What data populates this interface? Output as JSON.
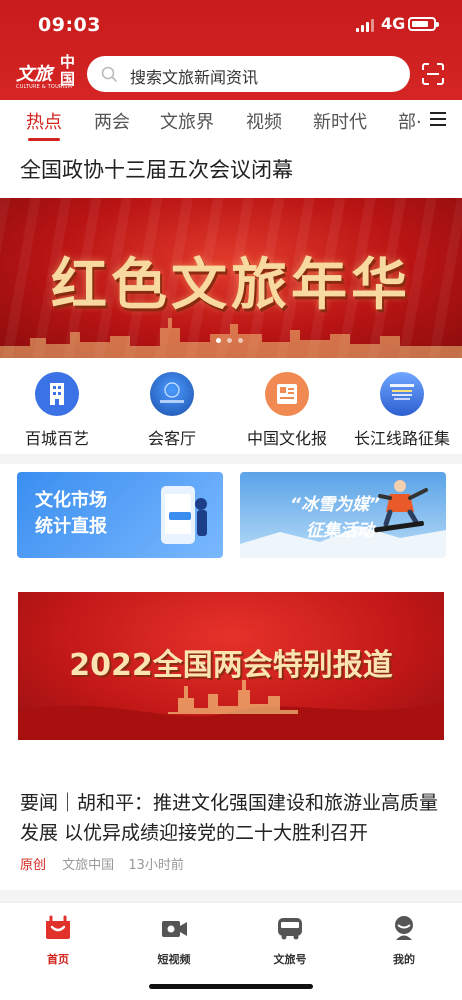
{
  "status_bar": {
    "time": "09:03",
    "network": "4G",
    "battery_level": 0.8
  },
  "header": {
    "logo_main": "文旅",
    "logo_side": "中国",
    "logo_sub": "CULTURE & TOURISM",
    "search_placeholder": "搜索文旅新闻资讯",
    "brand_color": "#d3251f"
  },
  "tabs": {
    "items": [
      {
        "label": "热点",
        "active": true
      },
      {
        "label": "两会",
        "active": false
      },
      {
        "label": "文旅界",
        "active": false
      },
      {
        "label": "视频",
        "active": false
      },
      {
        "label": "新时代",
        "active": false
      },
      {
        "label": "部·",
        "active": false
      }
    ]
  },
  "headline": "全国政协十三届五次会议闭幕",
  "hero_banner": {
    "title": "红色文旅年华",
    "slide_count": 3,
    "active_slide": 0
  },
  "quick_links": [
    {
      "label": "百城百艺",
      "icon": "building-icon",
      "color": "#3b72e6"
    },
    {
      "label": "会客厅",
      "icon": "globe-logo-icon",
      "color": "#2a6fd6"
    },
    {
      "label": "中国文化报",
      "icon": "newspaper-icon",
      "color": "#f08a52"
    },
    {
      "label": "长江线路征集",
      "icon": "poster-icon",
      "color": "#3a6ee0"
    }
  ],
  "promos": [
    {
      "lines": [
        "文化市场",
        "统计直报"
      ],
      "color": "#3a8ef0"
    },
    {
      "line1": "“冰雪为媒”",
      "line2": "征集活动",
      "color": "#5aa3e8"
    }
  ],
  "event_banner": {
    "title": "2022全国两会特别报道"
  },
  "article": {
    "title": "要闻｜胡和平：推进文化强国建设和旅游业高质量发展 以优异成绩迎接党的二十大胜利召开",
    "tag": "原创",
    "source": "文旅中国",
    "time": "13小时前"
  },
  "bottom_nav": [
    {
      "label": "首页",
      "icon": "home-icon",
      "active": true
    },
    {
      "label": "短视频",
      "icon": "video-camera-icon",
      "active": false
    },
    {
      "label": "文旅号",
      "icon": "bus-icon",
      "active": false
    },
    {
      "label": "我的",
      "icon": "profile-icon",
      "active": false
    }
  ]
}
